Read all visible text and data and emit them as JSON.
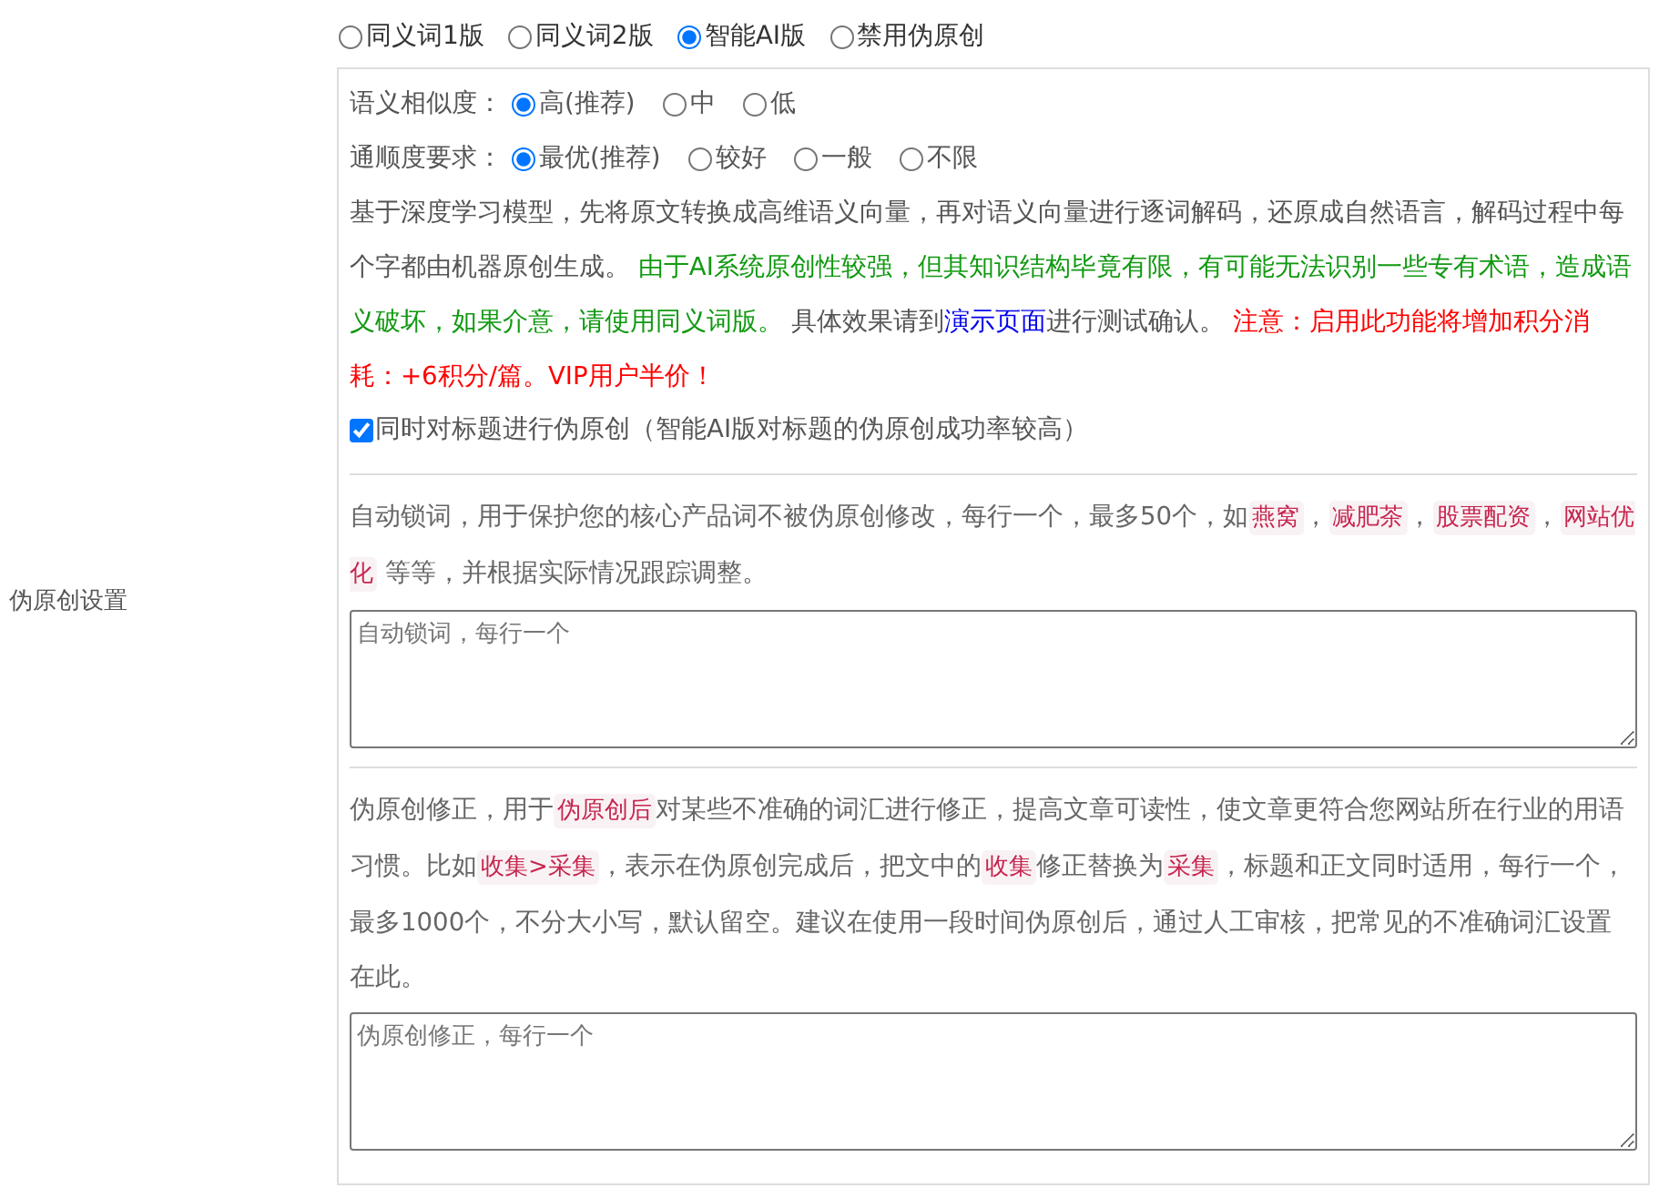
{
  "mode_options": [
    {
      "label": "同义词1版",
      "selected": false
    },
    {
      "label": "同义词2版",
      "selected": false
    },
    {
      "label": "智能AI版",
      "selected": true
    },
    {
      "label": "禁用伪原创",
      "selected": false
    }
  ],
  "settings_label": "伪原创设置",
  "similarity": {
    "label": "语义相似度：",
    "options": [
      {
        "label": "高(推荐)",
        "selected": true
      },
      {
        "label": "中",
        "selected": false
      },
      {
        "label": "低",
        "selected": false
      }
    ]
  },
  "fluency": {
    "label": "通顺度要求：",
    "options": [
      {
        "label": "最优(推荐)",
        "selected": true
      },
      {
        "label": "较好",
        "selected": false
      },
      {
        "label": "一般",
        "selected": false
      },
      {
        "label": "不限",
        "selected": false
      }
    ]
  },
  "ai_description": [
    {
      "kind": "plain",
      "text": "基于深度学习模型，先将原文转换成高维语义向量，再对语义向量进行逐词解码，还原成自然语言，解码过程中每个字都由机器原创生成。 "
    },
    {
      "kind": "notice",
      "text": "由于AI系统原创性较强，但其知识结构毕竟有限，有可能无法识别一些专有术语，造成语义破坏，如果介意，请使用同义词版。"
    },
    {
      "kind": "plain",
      "text": " 具体效果请到"
    },
    {
      "kind": "link",
      "text": "演示页面"
    },
    {
      "kind": "plain",
      "text": "进行测试确认。 "
    },
    {
      "kind": "warning",
      "text": "注意：启用此功能将增加积分消耗：+6积分/篇。VIP用户半价！"
    }
  ],
  "title_option": {
    "label": "同时对标题进行伪原创（智能AI版对标题的伪原创成功率较高）",
    "checked": true
  },
  "lock_words": {
    "description": [
      {
        "kind": "plain",
        "text": "自动锁词，用于保护您的核心产品词不被伪原创修改，每行一个，最多50个，如"
      },
      {
        "kind": "code",
        "text": "燕窝"
      },
      {
        "kind": "plain",
        "text": "，"
      },
      {
        "kind": "code",
        "text": "减肥茶"
      },
      {
        "kind": "plain",
        "text": "，"
      },
      {
        "kind": "code",
        "text": "股票配资"
      },
      {
        "kind": "plain",
        "text": "，"
      },
      {
        "kind": "code",
        "text": "网站优化"
      },
      {
        "kind": "plain",
        "text": " 等等，并根据实际情况跟踪调整。"
      }
    ],
    "placeholder": "自动锁词，每行一个"
  },
  "corrections": {
    "description": [
      {
        "kind": "plain",
        "text": "伪原创修正，用于"
      },
      {
        "kind": "code",
        "text": "伪原创后"
      },
      {
        "kind": "plain",
        "text": "对某些不准确的词汇进行修正，提高文章可读性，使文章更符合您网站所在行业的用语习惯。比如"
      },
      {
        "kind": "code",
        "text": "收集>采集"
      },
      {
        "kind": "plain",
        "text": "，表示在伪原创完成后，把文中的"
      },
      {
        "kind": "code",
        "text": "收集"
      },
      {
        "kind": "plain",
        "text": "修正替换为"
      },
      {
        "kind": "code",
        "text": "采集"
      },
      {
        "kind": "plain",
        "text": "，标题和正文同时适用，每行一个，最多1000个，不分大小写，默认留空。建议在使用一段时间伪原创后，通过人工审核，把常见的不准确词汇设置在此。"
      }
    ],
    "placeholder": "伪原创修正，每行一个"
  }
}
